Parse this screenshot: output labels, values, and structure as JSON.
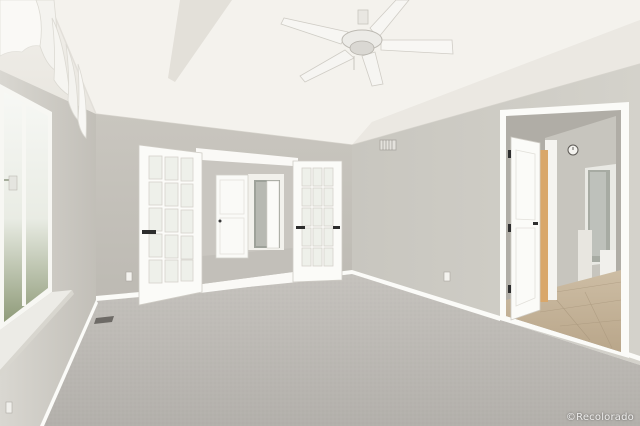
{
  "photo": {
    "watermark": "©Recolorado"
  },
  "palette": {
    "ceiling": "#f3f1ec",
    "wall": "#c7c4bd",
    "carpet": "#bdb9b4",
    "trim": "#fbfbf8",
    "tile": "#c6b49a"
  }
}
